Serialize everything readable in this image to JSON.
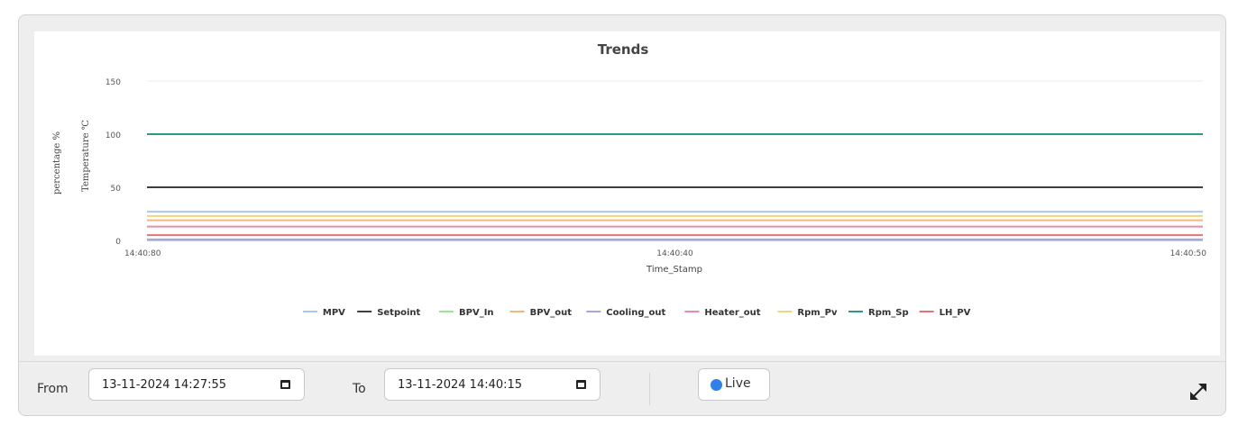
{
  "chart_data": {
    "type": "line",
    "title": "Trends",
    "xlabel": "Time_Stamp",
    "ylabels": [
      "percentage %",
      "Temperature ℃"
    ],
    "ylim": [
      0,
      150
    ],
    "y_ticks": [
      0,
      50,
      100,
      150
    ],
    "x_tick_labels": [
      "14:40:80",
      "14:40:40",
      "14:40:50"
    ],
    "grid": true,
    "legend_position": "bottom",
    "series": [
      {
        "name": "MPV",
        "color": "#a7c8ec",
        "values": [
          27,
          27
        ]
      },
      {
        "name": "Setpoint",
        "color": "#3e3e3e",
        "values": [
          50,
          50
        ]
      },
      {
        "name": "BPV_In",
        "color": "#98e698",
        "values": [
          0,
          0
        ]
      },
      {
        "name": "BPV_out",
        "color": "#f5b580",
        "values": [
          19,
          19
        ]
      },
      {
        "name": "Cooling_out",
        "color": "#a5a5ea",
        "values": [
          1,
          1
        ]
      },
      {
        "name": "Heater_out",
        "color": "#ef8aa5",
        "values": [
          13,
          13
        ]
      },
      {
        "name": "Rpm_Pv",
        "color": "#f2d579",
        "values": [
          23,
          23
        ]
      },
      {
        "name": "Rpm_Sp",
        "color": "#2a9a86",
        "values": [
          100,
          100
        ]
      },
      {
        "name": "LH_PV",
        "color": "#ec6f73",
        "values": [
          5,
          5
        ]
      }
    ]
  },
  "controls": {
    "from_label": "From",
    "from_value": "13-11-2024 14:27:55",
    "to_label": "To",
    "to_value": "13-11-2024 14:40:15",
    "live_label": "Live",
    "live_color": "#2f80ed",
    "calendar_icon": "calendar-icon",
    "expand_icon": "expand-icon"
  }
}
